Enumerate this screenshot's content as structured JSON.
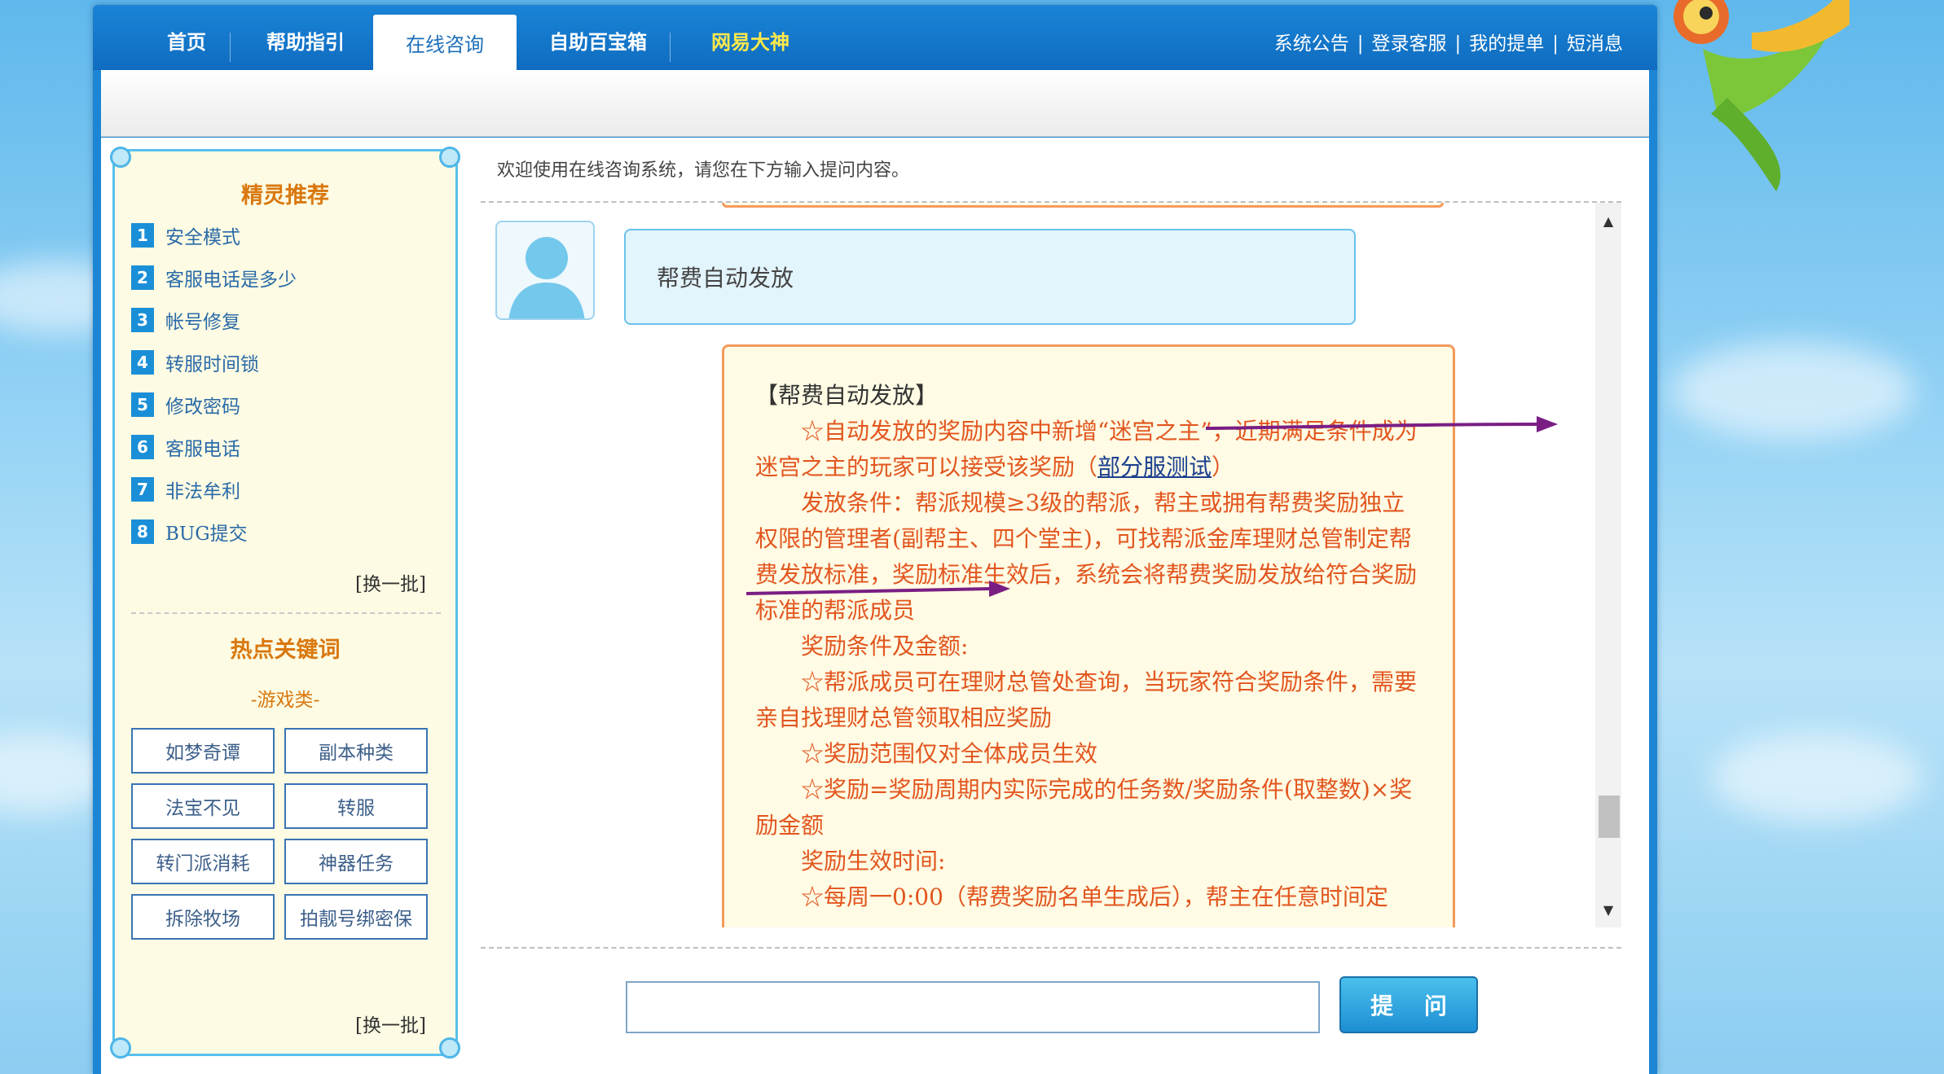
{
  "nav": {
    "items": [
      {
        "label": "首页"
      },
      {
        "label": "帮助指引"
      },
      {
        "label": "在线咨询"
      },
      {
        "label": "自助百宝箱"
      },
      {
        "label": "网易大神"
      }
    ],
    "top_links": [
      "系统公告",
      "登录客服",
      "我的提单",
      "短消息"
    ],
    "separator": "|"
  },
  "sidebar": {
    "recommend_title": "精灵推荐",
    "recommend_items": [
      {
        "num": "1",
        "label": "安全模式"
      },
      {
        "num": "2",
        "label": "客服电话是多少"
      },
      {
        "num": "3",
        "label": "帐号修复"
      },
      {
        "num": "4",
        "label": "转服时间锁"
      },
      {
        "num": "5",
        "label": "修改密码"
      },
      {
        "num": "6",
        "label": "客服电话"
      },
      {
        "num": "7",
        "label": "非法牟利"
      },
      {
        "num": "8",
        "label": "BUG提交"
      }
    ],
    "swap_label": "[换一批]",
    "hot_title": "热点关键词",
    "category": "-游戏类-",
    "keywords": [
      "如梦奇谭",
      "副本种类",
      "法宝不见",
      "转服",
      "转门派消耗",
      "神器任务",
      "拆除牧场",
      "拍靓号绑密保"
    ]
  },
  "main": {
    "welcome": "欢迎使用在线咨询系统，请您在下方输入提问内容。",
    "question": "帮费自动发放",
    "answer": {
      "title": "【帮费自动发放】",
      "p1": "☆自动发放的奖励内容中新增“迷宫之主”，近期满足条件成为迷宫之主的玩家可以接受该奖励（",
      "p1_link": "部分服测试",
      "p1_end": "）",
      "p2": "发放条件：帮派规模≥3级的帮派，帮主或拥有帮费奖励独立权限的管理者(副帮主、四个堂主)，可找帮派金库理财总管制定帮费发放标准，奖励标准生效后，系统会将帮费奖励发放给符合奖励标准的帮派成员",
      "p3": "奖励条件及金额:",
      "p4": "☆帮派成员可在理财总管处查询，当玩家符合奖励条件，需要亲自找理财总管领取相应奖励",
      "p5": "☆奖励范围仅对全体成员生效",
      "p6": "☆奖励=奖励周期内实际完成的任务数/奖励条件(取整数)×奖励金额",
      "p7": "奖励生效时间:",
      "p8": "☆每周一0:00（帮费奖励名单生成后），帮主在任意时间定"
    },
    "ask_button": "提 问",
    "ask_value": ""
  },
  "colors": {
    "nav_bg": "#1a84d6",
    "accent_orange": "#d9780f",
    "answer_text": "#e2561f",
    "answer_border": "#f39a5a",
    "question_bg": "#e2f4fc",
    "sidebar_bg": "#fdfbe3",
    "arrow": "#7a1e84"
  },
  "icons": [
    "avatar-silhouette-icon",
    "scroll-up-icon",
    "scroll-down-icon",
    "corner-swirl-icon",
    "fish-ornament-icon"
  ]
}
